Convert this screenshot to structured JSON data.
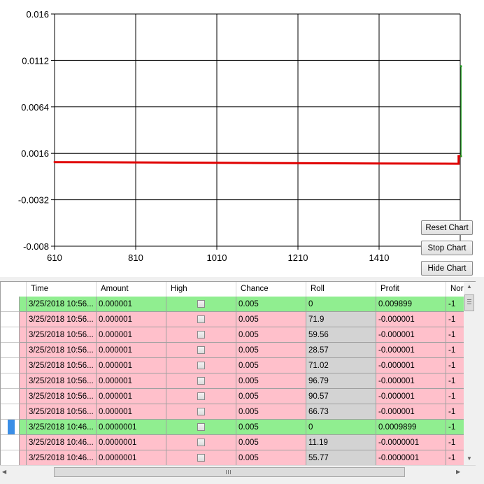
{
  "chart_data": {
    "type": "line",
    "yticks": [
      "0.016",
      "0.0112",
      "0.0064",
      "0.0016",
      "-0.0032",
      "-0.008"
    ],
    "xticks": [
      "610",
      "810",
      "1010",
      "1210",
      "1410"
    ],
    "ylim": [
      -0.008,
      0.016
    ],
    "xlim": [
      610,
      1610
    ],
    "grid": true,
    "series": [
      {
        "color": "#e00000",
        "points": [
          [
            610,
            0.0007
          ],
          [
            1010,
            0.00062
          ],
          [
            1410,
            0.00055
          ],
          [
            1606,
            0.00052
          ],
          [
            1606,
            0.0013
          ],
          [
            1612,
            0.0013
          ]
        ]
      },
      {
        "color": "#1a9a1a",
        "points": [
          [
            1612,
            0.0013
          ],
          [
            1612,
            0.0106
          ]
        ]
      }
    ]
  },
  "buttons": {
    "reset": "Reset Chart",
    "stop": "Stop Chart",
    "hide": "Hide Chart"
  },
  "grid": {
    "columns": [
      "Time",
      "Amount",
      "High",
      "Chance",
      "Roll",
      "Profit",
      "Nor"
    ],
    "rows": [
      {
        "time": "3/25/2018 10:56...",
        "amount": "0.000001",
        "chance": "0.005",
        "roll": "0",
        "profit": "0.009899",
        "nor": "-1",
        "win": true,
        "selected": false
      },
      {
        "time": "3/25/2018 10:56...",
        "amount": "0.000001",
        "chance": "0.005",
        "roll": "71.9",
        "profit": "-0.000001",
        "nor": "-1",
        "win": false,
        "selected": false
      },
      {
        "time": "3/25/2018 10:56...",
        "amount": "0.000001",
        "chance": "0.005",
        "roll": "59.56",
        "profit": "-0.000001",
        "nor": "-1",
        "win": false,
        "selected": false
      },
      {
        "time": "3/25/2018 10:56...",
        "amount": "0.000001",
        "chance": "0.005",
        "roll": "28.57",
        "profit": "-0.000001",
        "nor": "-1",
        "win": false,
        "selected": false
      },
      {
        "time": "3/25/2018 10:56...",
        "amount": "0.000001",
        "chance": "0.005",
        "roll": "71.02",
        "profit": "-0.000001",
        "nor": "-1",
        "win": false,
        "selected": false
      },
      {
        "time": "3/25/2018 10:56...",
        "amount": "0.000001",
        "chance": "0.005",
        "roll": "96.79",
        "profit": "-0.000001",
        "nor": "-1",
        "win": false,
        "selected": false
      },
      {
        "time": "3/25/2018 10:56...",
        "amount": "0.000001",
        "chance": "0.005",
        "roll": "90.57",
        "profit": "-0.000001",
        "nor": "-1",
        "win": false,
        "selected": false
      },
      {
        "time": "3/25/2018 10:56...",
        "amount": "0.000001",
        "chance": "0.005",
        "roll": "66.73",
        "profit": "-0.000001",
        "nor": "-1",
        "win": false,
        "selected": false
      },
      {
        "time": "3/25/2018 10:46...",
        "amount": "0.0000001",
        "chance": "0.005",
        "roll": "0",
        "profit": "0.0009899",
        "nor": "-1",
        "win": true,
        "selected": true
      },
      {
        "time": "3/25/2018 10:46...",
        "amount": "0.0000001",
        "chance": "0.005",
        "roll": "11.19",
        "profit": "-0.0000001",
        "nor": "-1",
        "win": false,
        "selected": false
      },
      {
        "time": "3/25/2018 10:46...",
        "amount": "0.0000001",
        "chance": "0.005",
        "roll": "55.77",
        "profit": "-0.0000001",
        "nor": "-1",
        "win": false,
        "selected": false
      }
    ]
  },
  "colors": {
    "win_row": "#90ee90",
    "loss_row": "#ffc0cb",
    "roll_cell_loss": "#d3d3d3"
  },
  "icons": {
    "scroll_up": "scroll-up-arrow-icon",
    "scroll_down": "scroll-down-arrow-icon",
    "scroll_left": "scroll-left-arrow-icon",
    "scroll_right": "scroll-right-arrow-icon"
  }
}
